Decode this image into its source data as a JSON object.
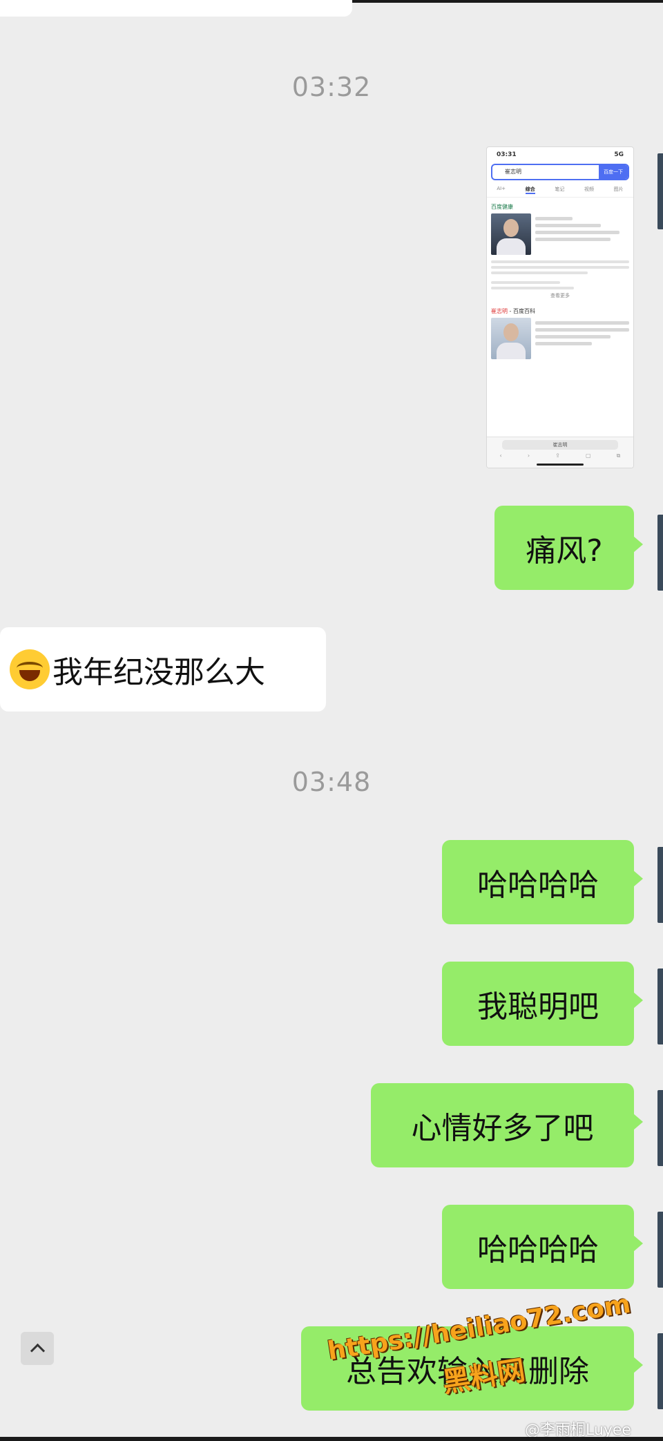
{
  "timestamps": [
    "03:32",
    "03:48"
  ],
  "messages": {
    "m1": "痛风?",
    "m2": "我年纪没那么大",
    "m3": "哈哈哈哈",
    "m4": "我聪明吧",
    "m5": "心情好多了吧",
    "m6": "哈哈哈哈",
    "m7": "总告欢输入又删除"
  },
  "thumbnail": {
    "time": "03:31",
    "status_right": "5G",
    "search_query": "崔志明",
    "search_button": "百度一下",
    "tabs": [
      "AI+",
      "综合",
      "笔记",
      "视频",
      "图片"
    ],
    "section1": "百度健康",
    "more": "查看更多",
    "section2_name": "崔志明",
    "section2_suffix": " - 百度百科",
    "url": "崔志明"
  },
  "watermark": {
    "line1": "https://heiliao72.com",
    "line2": "黑料网"
  },
  "credit": "@李雨桐Luyee",
  "colors": {
    "background": "#ededed",
    "outgoing_bubble": "#95ec69",
    "incoming_bubble": "#ffffff",
    "timestamp": "#9a9a9a",
    "watermark": "#f7a31c"
  },
  "icons": [
    "laughing-tears-emoji-icon",
    "chevron-up-icon"
  ]
}
